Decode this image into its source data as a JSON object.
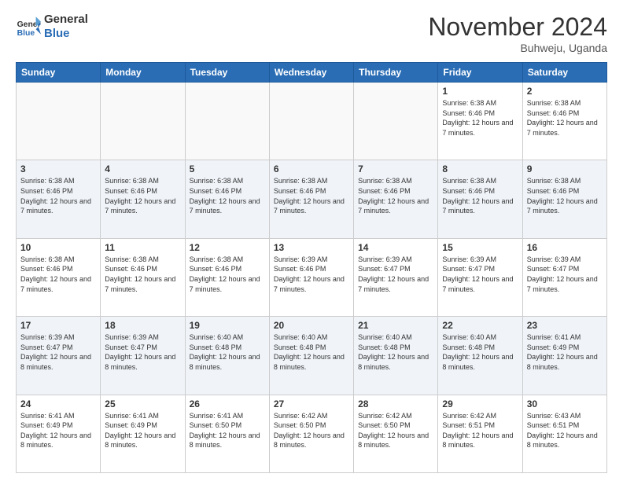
{
  "logo": {
    "line1": "General",
    "line2": "Blue"
  },
  "title": "November 2024",
  "subtitle": "Buhweju, Uganda",
  "headers": [
    "Sunday",
    "Monday",
    "Tuesday",
    "Wednesday",
    "Thursday",
    "Friday",
    "Saturday"
  ],
  "weeks": [
    [
      {
        "day": "",
        "info": ""
      },
      {
        "day": "",
        "info": ""
      },
      {
        "day": "",
        "info": ""
      },
      {
        "day": "",
        "info": ""
      },
      {
        "day": "",
        "info": ""
      },
      {
        "day": "1",
        "info": "Sunrise: 6:38 AM\nSunset: 6:46 PM\nDaylight: 12 hours and 7 minutes."
      },
      {
        "day": "2",
        "info": "Sunrise: 6:38 AM\nSunset: 6:46 PM\nDaylight: 12 hours and 7 minutes."
      }
    ],
    [
      {
        "day": "3",
        "info": "Sunrise: 6:38 AM\nSunset: 6:46 PM\nDaylight: 12 hours and 7 minutes."
      },
      {
        "day": "4",
        "info": "Sunrise: 6:38 AM\nSunset: 6:46 PM\nDaylight: 12 hours and 7 minutes."
      },
      {
        "day": "5",
        "info": "Sunrise: 6:38 AM\nSunset: 6:46 PM\nDaylight: 12 hours and 7 minutes."
      },
      {
        "day": "6",
        "info": "Sunrise: 6:38 AM\nSunset: 6:46 PM\nDaylight: 12 hours and 7 minutes."
      },
      {
        "day": "7",
        "info": "Sunrise: 6:38 AM\nSunset: 6:46 PM\nDaylight: 12 hours and 7 minutes."
      },
      {
        "day": "8",
        "info": "Sunrise: 6:38 AM\nSunset: 6:46 PM\nDaylight: 12 hours and 7 minutes."
      },
      {
        "day": "9",
        "info": "Sunrise: 6:38 AM\nSunset: 6:46 PM\nDaylight: 12 hours and 7 minutes."
      }
    ],
    [
      {
        "day": "10",
        "info": "Sunrise: 6:38 AM\nSunset: 6:46 PM\nDaylight: 12 hours and 7 minutes."
      },
      {
        "day": "11",
        "info": "Sunrise: 6:38 AM\nSunset: 6:46 PM\nDaylight: 12 hours and 7 minutes."
      },
      {
        "day": "12",
        "info": "Sunrise: 6:38 AM\nSunset: 6:46 PM\nDaylight: 12 hours and 7 minutes."
      },
      {
        "day": "13",
        "info": "Sunrise: 6:39 AM\nSunset: 6:46 PM\nDaylight: 12 hours and 7 minutes."
      },
      {
        "day": "14",
        "info": "Sunrise: 6:39 AM\nSunset: 6:47 PM\nDaylight: 12 hours and 7 minutes."
      },
      {
        "day": "15",
        "info": "Sunrise: 6:39 AM\nSunset: 6:47 PM\nDaylight: 12 hours and 7 minutes."
      },
      {
        "day": "16",
        "info": "Sunrise: 6:39 AM\nSunset: 6:47 PM\nDaylight: 12 hours and 7 minutes."
      }
    ],
    [
      {
        "day": "17",
        "info": "Sunrise: 6:39 AM\nSunset: 6:47 PM\nDaylight: 12 hours and 8 minutes."
      },
      {
        "day": "18",
        "info": "Sunrise: 6:39 AM\nSunset: 6:47 PM\nDaylight: 12 hours and 8 minutes."
      },
      {
        "day": "19",
        "info": "Sunrise: 6:40 AM\nSunset: 6:48 PM\nDaylight: 12 hours and 8 minutes."
      },
      {
        "day": "20",
        "info": "Sunrise: 6:40 AM\nSunset: 6:48 PM\nDaylight: 12 hours and 8 minutes."
      },
      {
        "day": "21",
        "info": "Sunrise: 6:40 AM\nSunset: 6:48 PM\nDaylight: 12 hours and 8 minutes."
      },
      {
        "day": "22",
        "info": "Sunrise: 6:40 AM\nSunset: 6:48 PM\nDaylight: 12 hours and 8 minutes."
      },
      {
        "day": "23",
        "info": "Sunrise: 6:41 AM\nSunset: 6:49 PM\nDaylight: 12 hours and 8 minutes."
      }
    ],
    [
      {
        "day": "24",
        "info": "Sunrise: 6:41 AM\nSunset: 6:49 PM\nDaylight: 12 hours and 8 minutes."
      },
      {
        "day": "25",
        "info": "Sunrise: 6:41 AM\nSunset: 6:49 PM\nDaylight: 12 hours and 8 minutes."
      },
      {
        "day": "26",
        "info": "Sunrise: 6:41 AM\nSunset: 6:50 PM\nDaylight: 12 hours and 8 minutes."
      },
      {
        "day": "27",
        "info": "Sunrise: 6:42 AM\nSunset: 6:50 PM\nDaylight: 12 hours and 8 minutes."
      },
      {
        "day": "28",
        "info": "Sunrise: 6:42 AM\nSunset: 6:50 PM\nDaylight: 12 hours and 8 minutes."
      },
      {
        "day": "29",
        "info": "Sunrise: 6:42 AM\nSunset: 6:51 PM\nDaylight: 12 hours and 8 minutes."
      },
      {
        "day": "30",
        "info": "Sunrise: 6:43 AM\nSunset: 6:51 PM\nDaylight: 12 hours and 8 minutes."
      }
    ]
  ]
}
